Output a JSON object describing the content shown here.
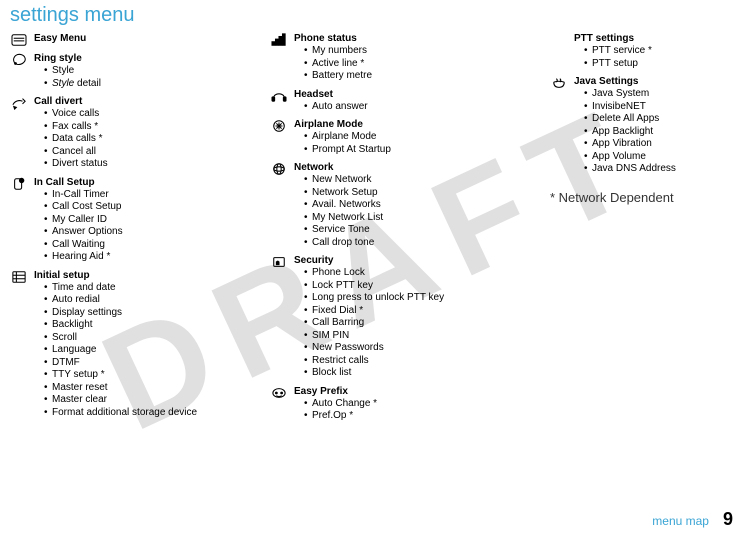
{
  "page_title": "settings menu",
  "watermark": "DRAFT",
  "footer": {
    "label": "menu map",
    "page": "9"
  },
  "footnote": "* Network Dependent",
  "columns": {
    "col1": [
      {
        "icon": "menu-icon",
        "heading": "Easy Menu",
        "items": []
      },
      {
        "icon": "ring-icon",
        "heading": "Ring style",
        "items": [
          {
            "label": "Style"
          },
          {
            "label": "Style",
            "italic": true,
            "suffix": " detail"
          }
        ]
      },
      {
        "icon": "divert-icon",
        "heading": "Call divert",
        "items": [
          {
            "label": "Voice calls"
          },
          {
            "label": "Fax calls *"
          },
          {
            "label": "Data calls *"
          },
          {
            "label": "Cancel all"
          },
          {
            "label": "Divert status"
          }
        ]
      },
      {
        "icon": "incall-icon",
        "heading": "In Call Setup",
        "items": [
          {
            "label": "In-Call Timer"
          },
          {
            "label": "Call Cost Setup"
          },
          {
            "label": "My Caller ID"
          },
          {
            "label": "Answer Options"
          },
          {
            "label": "Call Waiting"
          },
          {
            "label": "Hearing Aid *"
          }
        ]
      },
      {
        "icon": "initial-icon",
        "heading": "Initial setup",
        "items": [
          {
            "label": "Time and date"
          },
          {
            "label": "Auto redial"
          },
          {
            "label": "Display settings"
          },
          {
            "label": "Backlight"
          },
          {
            "label": "Scroll"
          },
          {
            "label": "Language"
          },
          {
            "label": "DTMF"
          },
          {
            "label": "TTY setup *"
          },
          {
            "label": "Master reset"
          },
          {
            "label": "Master clear"
          },
          {
            "label": "Format additional storage device"
          }
        ]
      }
    ],
    "col2": [
      {
        "icon": "phone-status-icon",
        "heading": "Phone status",
        "items": [
          {
            "label": "My numbers"
          },
          {
            "label": "Active line *"
          },
          {
            "label": "Battery metre"
          }
        ]
      },
      {
        "icon": "headset-icon",
        "heading": "Headset",
        "items": [
          {
            "label": "Auto answer"
          }
        ]
      },
      {
        "icon": "airplane-icon",
        "heading": "Airplane Mode",
        "items": [
          {
            "label": "Airplane Mode"
          },
          {
            "label": "Prompt At Startup"
          }
        ]
      },
      {
        "icon": "network-icon",
        "heading": "Network",
        "items": [
          {
            "label": "New Network"
          },
          {
            "label": "Network Setup"
          },
          {
            "label": "Avail. Networks"
          },
          {
            "label": "My Network List"
          },
          {
            "label": "Service Tone"
          },
          {
            "label": "Call drop tone"
          }
        ]
      },
      {
        "icon": "security-icon",
        "heading": "Security",
        "items": [
          {
            "label": "Phone Lock"
          },
          {
            "label": "Lock PTT key"
          },
          {
            "label": "Long press to unlock PTT key"
          },
          {
            "label": "Fixed Dial *"
          },
          {
            "label": "Call Barring"
          },
          {
            "label": "SIM PIN"
          },
          {
            "label": "New Passwords"
          },
          {
            "label": "Restrict calls"
          },
          {
            "label": "Block list"
          }
        ]
      },
      {
        "icon": "prefix-icon",
        "heading": "Easy Prefix",
        "items": [
          {
            "label": "Auto Change *"
          },
          {
            "label": "Pref.Op *"
          }
        ]
      }
    ],
    "col3": [
      {
        "icon": null,
        "heading": "PTT settings",
        "items": [
          {
            "label": "PTT service *"
          },
          {
            "label": "PTT setup"
          }
        ]
      },
      {
        "icon": "java-icon",
        "heading": "Java Settings",
        "items": [
          {
            "label": "Java System"
          },
          {
            "label": "InvisibeNET"
          },
          {
            "label": "Delete All Apps"
          },
          {
            "label": "App Backlight"
          },
          {
            "label": "App Vibration"
          },
          {
            "label": "App Volume"
          },
          {
            "label": "Java DNS Address"
          }
        ]
      }
    ]
  }
}
